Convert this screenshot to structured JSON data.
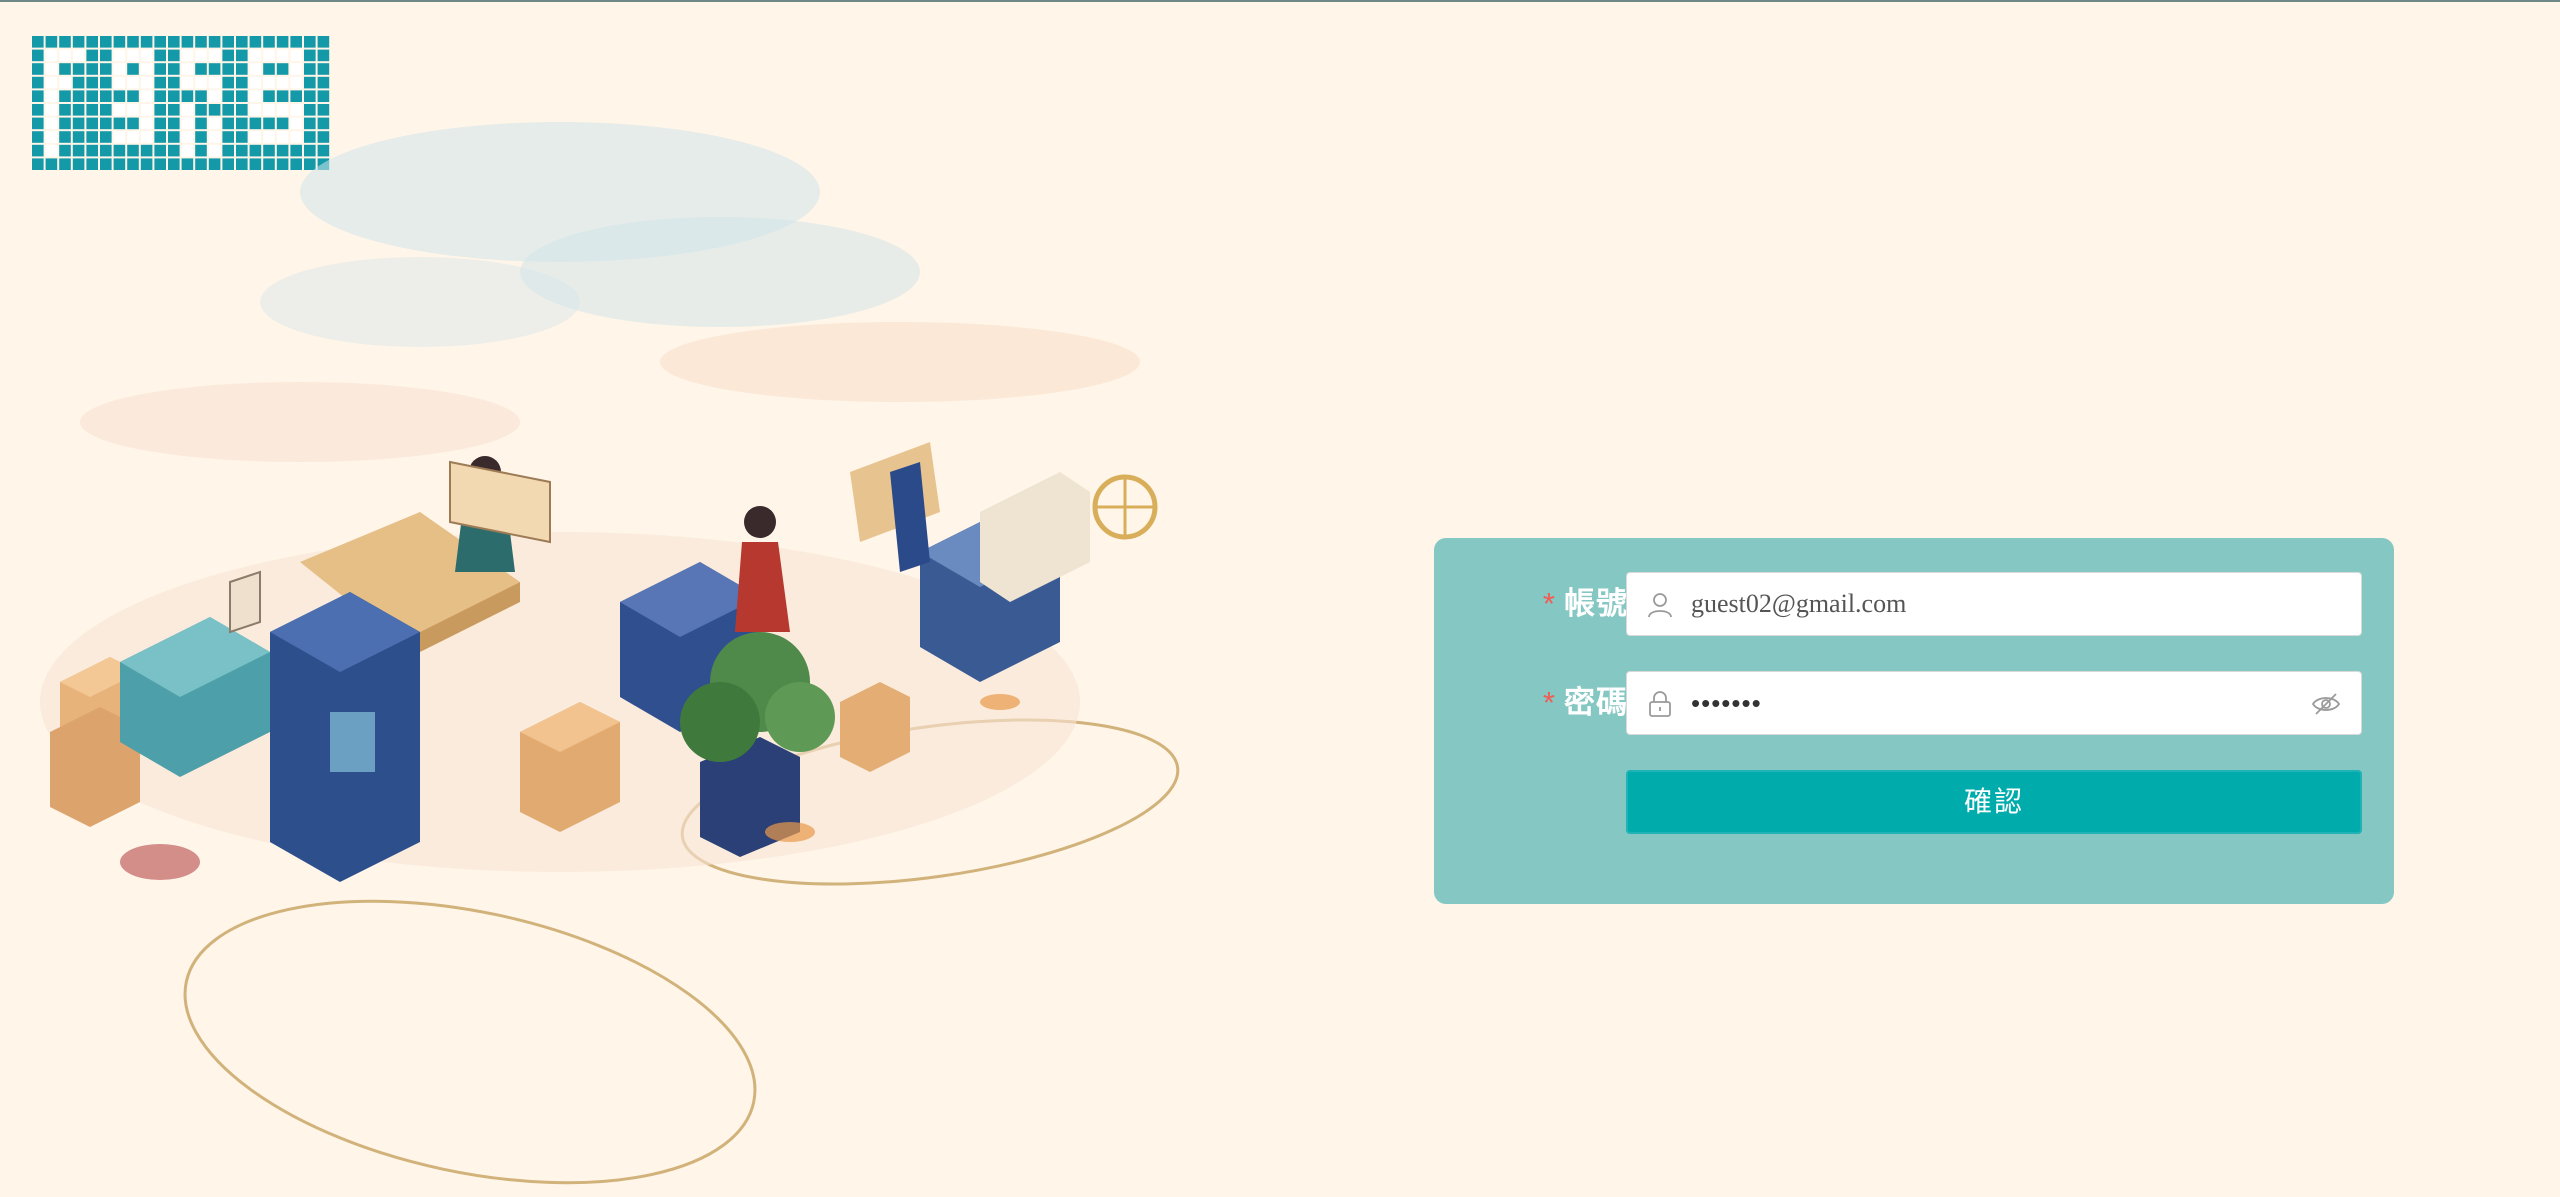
{
  "colors": {
    "page_background": "#fff5e8",
    "logo_teal": "#1399a8",
    "panel_background": "#85c7c2",
    "button_background": "#00abac",
    "required_marker": "#f25c54"
  },
  "logo": {
    "icon": "pixel-mosaic-logo"
  },
  "illustration": {
    "icon": "isometric-market-illustration"
  },
  "login": {
    "account": {
      "required_mark": "*",
      "label": "帳號",
      "icon": "user-icon",
      "value": "guest02@gmail.com"
    },
    "password": {
      "required_mark": "*",
      "label": "密碼",
      "icon": "lock-icon",
      "masked_value": "•••••••",
      "toggle_icon": "eye-slash-icon"
    },
    "submit": {
      "label": "確認"
    }
  }
}
